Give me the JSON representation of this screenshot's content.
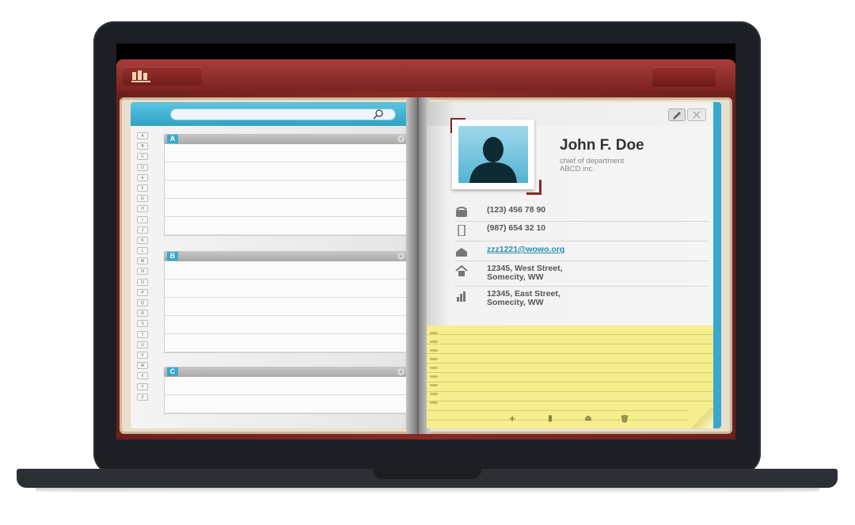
{
  "app": {
    "search": {
      "placeholder": ""
    },
    "alphabet": [
      "A",
      "B",
      "C",
      "D",
      "E",
      "F",
      "G",
      "H",
      "I",
      "J",
      "K",
      "L",
      "M",
      "N",
      "O",
      "P",
      "Q",
      "R",
      "S",
      "T",
      "U",
      "V",
      "W",
      "X",
      "Y",
      "Z"
    ],
    "sections": [
      {
        "letter": "A"
      },
      {
        "letter": "B"
      },
      {
        "letter": "C"
      }
    ],
    "contact": {
      "name": "John F. Doe",
      "title": "chief of department",
      "company": "ABCD inc.",
      "phone": "(123) 456 78 90",
      "mobile": "(987) 654 32 10",
      "email": "zzz1221@wowo.org",
      "address_home_line1": "12345, West Street,",
      "address_home_line2": "Somecity, WW",
      "address_work_line1": "12345, East Street,",
      "address_work_line2": "Somecity, WW"
    },
    "note_toolbar": {
      "add": "+",
      "bookmark": "▮",
      "share": "⏏",
      "trash": "🗑"
    }
  },
  "colors": {
    "leather_red": "#8a2a26",
    "accent_blue": "#36a9cc",
    "notepad_yellow": "#f5ee8f",
    "laptop_body": "#1c2024"
  }
}
